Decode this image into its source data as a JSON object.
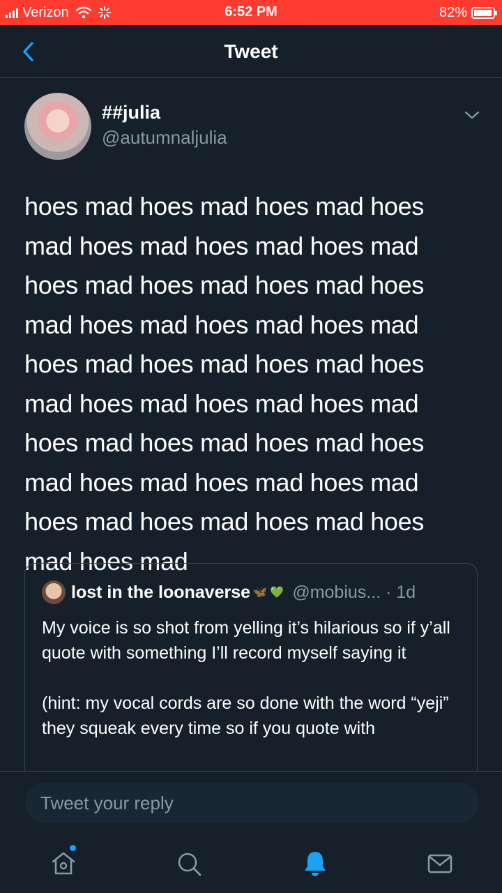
{
  "status_bar": {
    "carrier": "Verizon",
    "time": "6:52 PM",
    "battery": "82%"
  },
  "header": {
    "title": "Tweet",
    "back_icon": "chevron-left-icon"
  },
  "tweet": {
    "display_name": "##julia",
    "handle": "@autumnaljulia",
    "text": "hoes mad hoes mad hoes mad hoes mad hoes mad hoes mad hoes mad hoes mad hoes mad hoes mad hoes mad hoes mad hoes mad hoes mad hoes mad hoes mad hoes mad hoes mad hoes mad hoes mad hoes mad hoes mad hoes mad hoes mad hoes mad hoes mad hoes mad hoes mad hoes mad hoes mad hoes mad hoes mad hoes mad"
  },
  "quoted_tweet": {
    "display_name": "lost in the loonaverse",
    "emojis": "🦋 💚",
    "handle_time": "@mobius... · 1d",
    "text": "My voice is so shot from yelling it’s hilarious so if y’all quote with something I’ll record myself saying it\n\n(hint: my vocal cords are so done with the word “yeji” they squeak every time so if you quote with"
  },
  "reply": {
    "placeholder": "Tweet your reply"
  },
  "nav": {
    "items": [
      "home-icon",
      "search-icon",
      "notifications-icon",
      "messages-icon"
    ],
    "active": "notifications-icon"
  },
  "colors": {
    "background": "#15202b",
    "accent": "#1da1f2",
    "status_bar": "#ff3b30",
    "secondary_text": "#8899a6"
  }
}
